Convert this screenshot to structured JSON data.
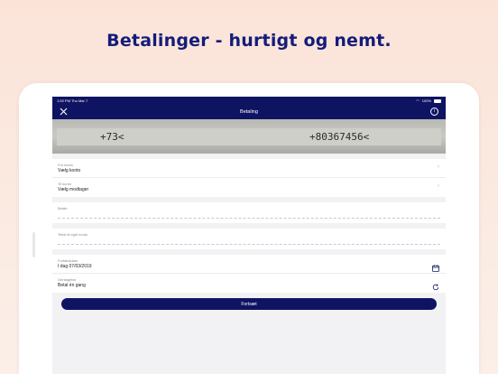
{
  "headline": "Betalinger - hurtigt og nemt.",
  "status_bar": {
    "time": "1:53 PM",
    "date": "Thu Mar 7",
    "battery": "100%"
  },
  "nav": {
    "title": "Betaling",
    "close_icon": "close-icon",
    "info_icon": "info-icon",
    "info_glyph": "i"
  },
  "camera": {
    "code_left": "+73<",
    "code_right": "+80367456<"
  },
  "fields": {
    "from_account": {
      "label": "Fra konto",
      "value": "Vælg konto"
    },
    "to_account": {
      "label": "Til konto",
      "value": "Vælg modtager"
    },
    "amount": {
      "label": "Beløb"
    },
    "own_text": {
      "label": "Tekst til eget konto"
    },
    "due_date": {
      "label": "Forfaldsdato",
      "value": "I dag 07/03/2019"
    },
    "repeat": {
      "label": "Gentagelse",
      "value": "Betal én gang"
    }
  },
  "continue_button": "Fortsæt",
  "colors": {
    "brand": "#0e1462",
    "background": "#fbe3d8"
  }
}
